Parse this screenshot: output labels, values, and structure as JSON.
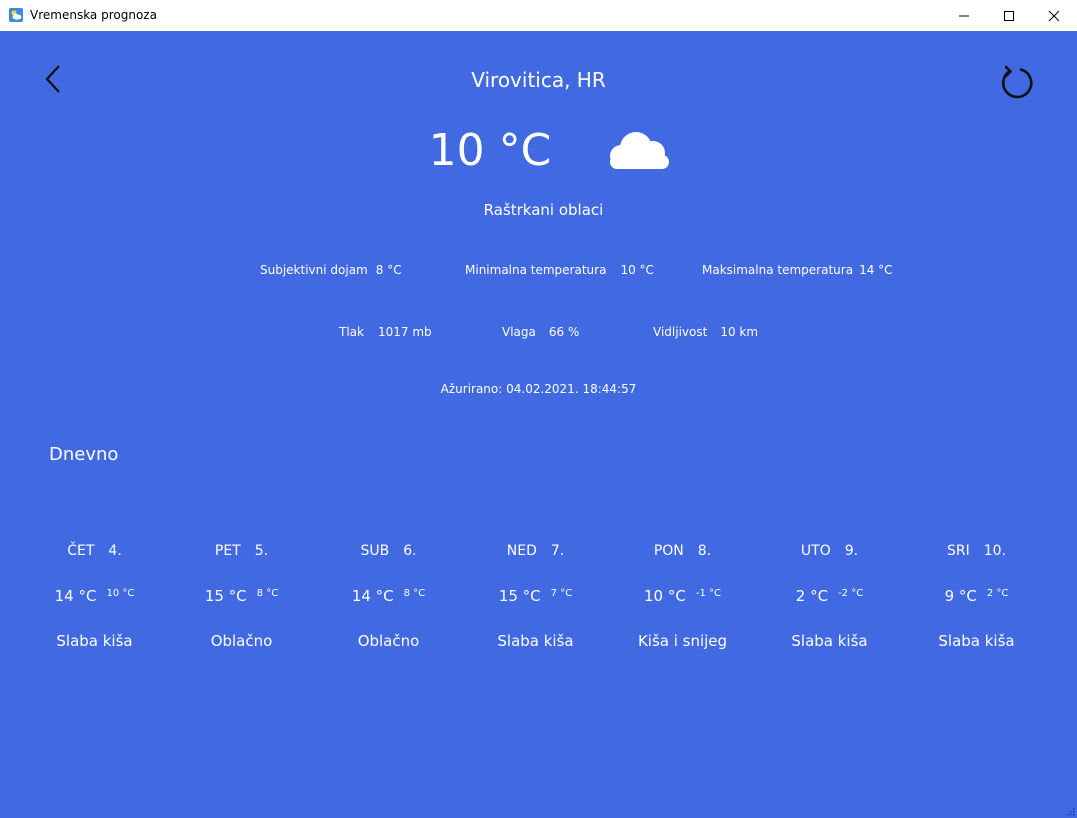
{
  "window": {
    "title": "Vremenska prognoza",
    "background": "#4169e1"
  },
  "icons": {
    "app": "weather-app-icon",
    "back": "chevron-left-icon",
    "refresh": "refresh-icon",
    "condition": "cloud-icon"
  },
  "current": {
    "city": "Virovitica, HR",
    "temperature": "10 °C",
    "description": "Raštrkani oblaci",
    "feels_like_label": "Subjektivni dojam",
    "feels_like_value": "8 °C",
    "min_label": "Minimalna temperatura",
    "min_value": "10 °C",
    "max_label": "Maksimalna temperatura",
    "max_value": "14 °C",
    "pressure_label": "Tlak",
    "pressure_value": "1017 mb",
    "humidity_label": "Vlaga",
    "humidity_value": "66 %",
    "visibility_label": "Vidljivost",
    "visibility_value": "10 km",
    "updated": "Ažurirano: 04.02.2021. 18:44:57"
  },
  "daily": {
    "title": "Dnevno",
    "days": [
      {
        "day": "ČET",
        "date": "4.",
        "high": "14 °C",
        "low": "10 °C",
        "desc": "Slaba kiša"
      },
      {
        "day": "PET",
        "date": "5.",
        "high": "15 °C",
        "low": "8 °C",
        "desc": "Oblačno"
      },
      {
        "day": "SUB",
        "date": "6.",
        "high": "14 °C",
        "low": "8 °C",
        "desc": "Oblačno"
      },
      {
        "day": "NED",
        "date": "7.",
        "high": "15 °C",
        "low": "7 °C",
        "desc": "Slaba kiša"
      },
      {
        "day": "PON",
        "date": "8.",
        "high": "10 °C",
        "low": "-1 °C",
        "desc": "Kiša i snijeg"
      },
      {
        "day": "UTO",
        "date": "9.",
        "high": "2 °C",
        "low": "-2 °C",
        "desc": "Slaba kiša"
      },
      {
        "day": "SRI",
        "date": "10.",
        "high": "9 °C",
        "low": "2 °C",
        "desc": "Slaba kiša"
      }
    ]
  }
}
